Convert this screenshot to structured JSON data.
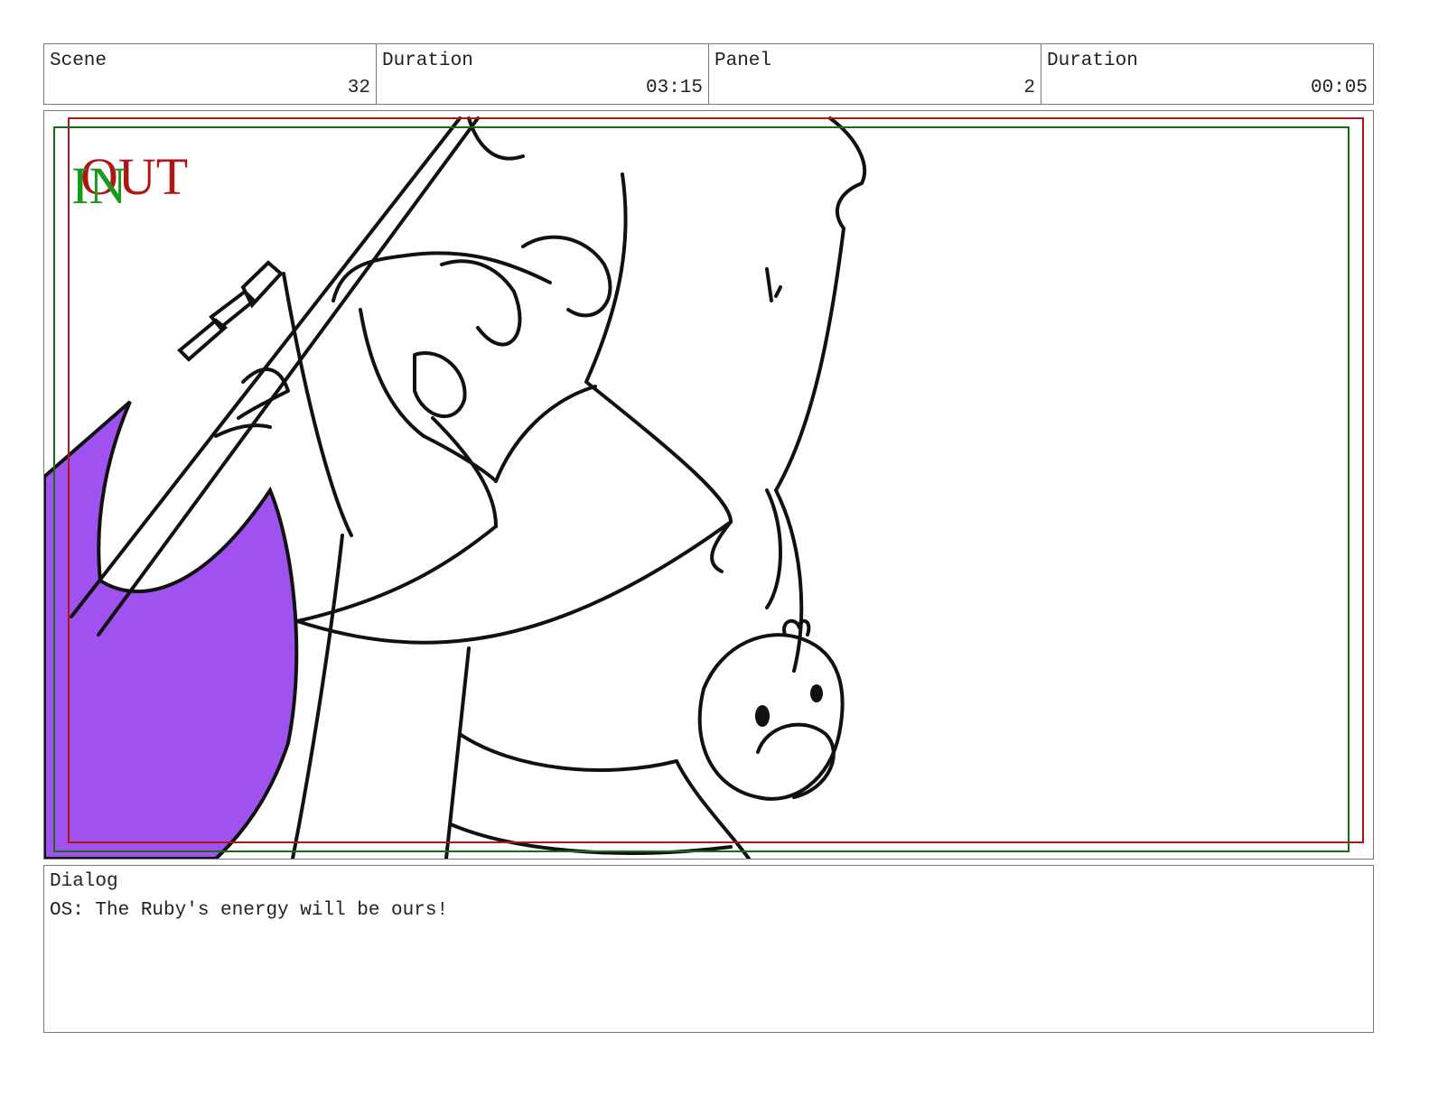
{
  "header": {
    "scene_label": "Scene",
    "scene_value": "32",
    "duration_label": "Duration",
    "duration_value": "03:15",
    "panel_label": "Panel",
    "panel_value": "2",
    "panel_duration_label": "Duration",
    "panel_duration_value": "00:05"
  },
  "frame": {
    "in_marker": "IN",
    "out_marker": "OUT",
    "in_color": "#1a9a1a",
    "out_color": "#b01515",
    "fill_color": "#a052f0"
  },
  "dialog": {
    "label": "Dialog",
    "text": "OS: The Ruby's energy will be ours!"
  }
}
